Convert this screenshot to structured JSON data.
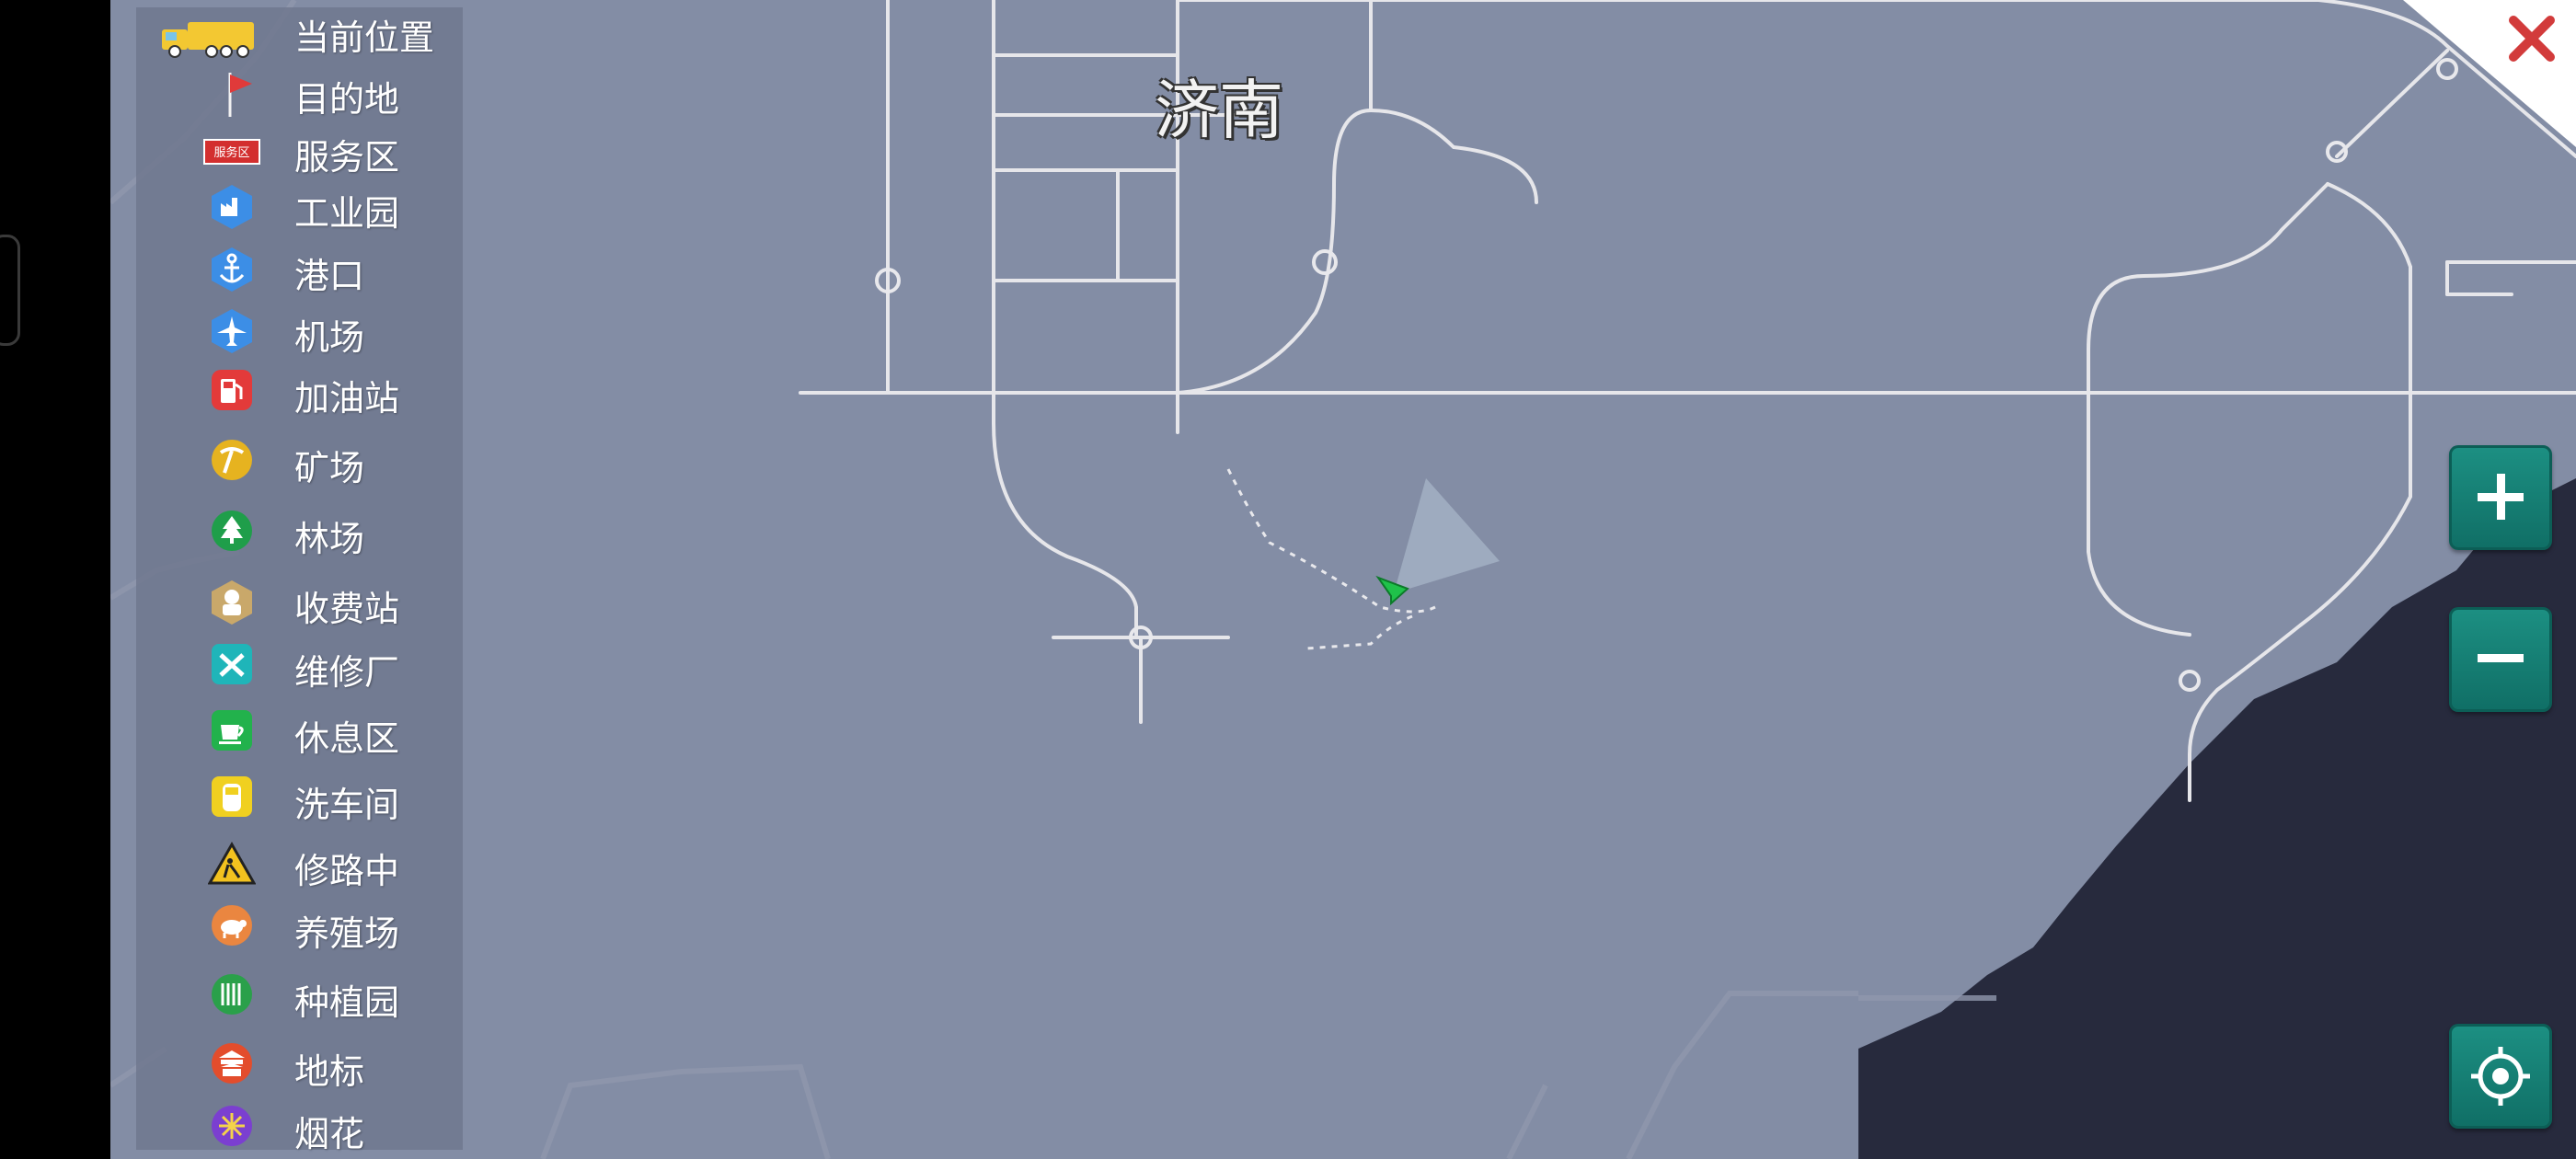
{
  "map": {
    "city_label": "济南"
  },
  "legend": {
    "items": [
      {
        "label": "当前位置",
        "icon": "truck-icon"
      },
      {
        "label": "目的地",
        "icon": "flag-icon"
      },
      {
        "label": "服务区",
        "icon": "service-area-sign-icon",
        "icon_text": "服务区"
      },
      {
        "label": "工业园",
        "icon": "factory-icon"
      },
      {
        "label": "港口",
        "icon": "anchor-icon"
      },
      {
        "label": "机场",
        "icon": "airplane-icon"
      },
      {
        "label": "加油站",
        "icon": "fuel-pump-icon"
      },
      {
        "label": "矿场",
        "icon": "pickaxe-icon"
      },
      {
        "label": "林场",
        "icon": "tree-icon"
      },
      {
        "label": "收费站",
        "icon": "toll-booth-icon"
      },
      {
        "label": "维修厂",
        "icon": "wrench-icon"
      },
      {
        "label": "休息区",
        "icon": "coffee-cup-icon"
      },
      {
        "label": "洗车间",
        "icon": "car-wash-icon"
      },
      {
        "label": "修路中",
        "icon": "road-work-icon"
      },
      {
        "label": "养殖场",
        "icon": "cow-icon"
      },
      {
        "label": "种植园",
        "icon": "crop-icon"
      },
      {
        "label": "地标",
        "icon": "landmark-icon"
      },
      {
        "label": "烟花",
        "icon": "fireworks-icon"
      }
    ]
  },
  "controls": {
    "zoom_in": "+",
    "zoom_out": "−",
    "locate": "locate-icon",
    "close": "close-icon"
  },
  "colors": {
    "land": "#838da5",
    "sea": "#272a3d",
    "road": "#e6e6ea",
    "button": "#138a7e",
    "close_x": "#d23b3b"
  }
}
